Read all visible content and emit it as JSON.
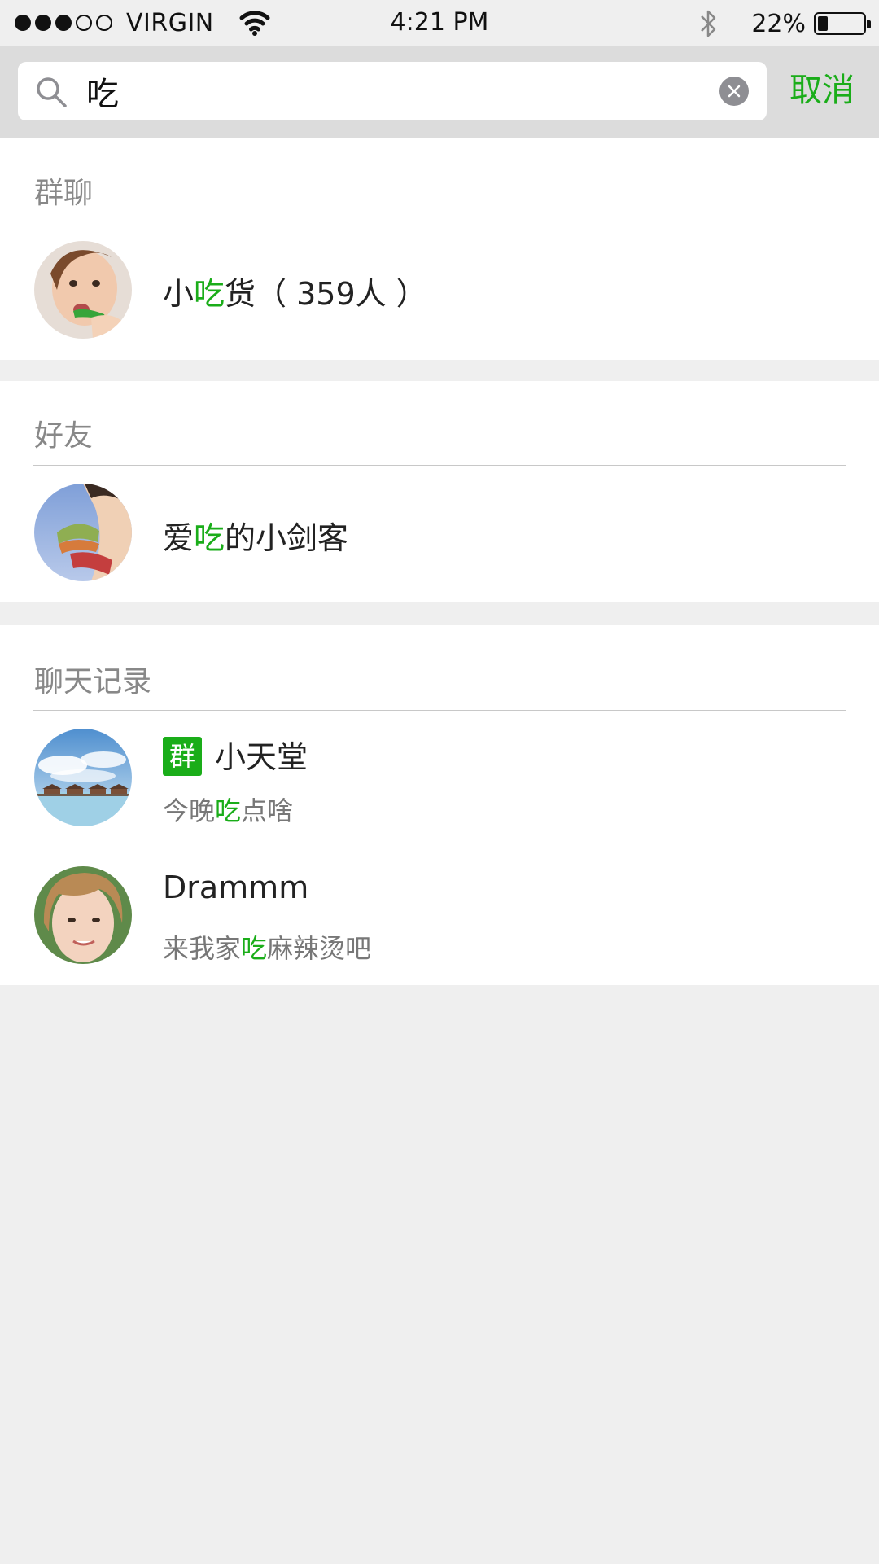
{
  "status_bar": {
    "carrier": "VIRGIN",
    "time": "4:21 PM",
    "battery_pct": "22%",
    "battery_level": 0.22,
    "signal_bars": 3,
    "signal_total": 5
  },
  "search": {
    "query": "吃",
    "cancel_label": "取消"
  },
  "sections": {
    "groups": {
      "title": "群聊",
      "items": [
        {
          "pre": "小",
          "match": "吃",
          "post": "货（ 359人 ）"
        }
      ]
    },
    "friends": {
      "title": "好友",
      "items": [
        {
          "pre": "爱",
          "match": "吃",
          "post": "的小剑客"
        }
      ]
    },
    "chat_history": {
      "title": "聊天记录",
      "items": [
        {
          "tag": "群",
          "name": "小天堂",
          "msg_pre": "今晚",
          "msg_match": "吃",
          "msg_post": "点啥"
        },
        {
          "name": "Drammm",
          "msg_pre": "来我家",
          "msg_match": "吃",
          "msg_post": "麻辣烫吧"
        }
      ]
    }
  },
  "colors": {
    "accent": "#1aad19",
    "background": "#efefef",
    "search_bar_bg": "#dcdcdc"
  }
}
